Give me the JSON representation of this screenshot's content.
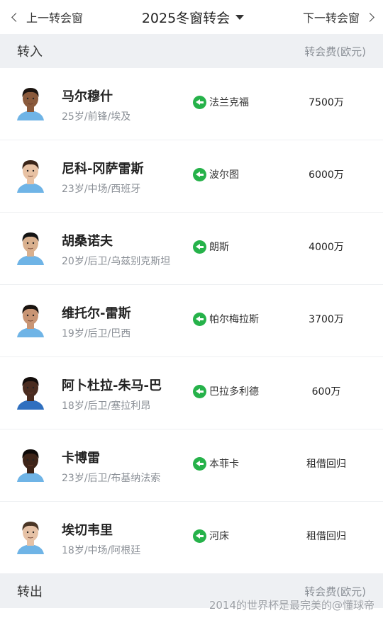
{
  "topbar": {
    "prev_label": "上一转会窗",
    "title": "2025冬窗转会",
    "next_label": "下一转会窗"
  },
  "transfer_in": {
    "label": "转入",
    "fee_header": "转会费(欧元)",
    "players": [
      {
        "name": "马尔穆什",
        "meta": "25岁/前锋/埃及",
        "club": "法兰克福",
        "fee": "7500万",
        "skin": "#8a5a3c",
        "hair": "#1b1410",
        "shirt": "#6fb4e6"
      },
      {
        "name": "尼科-冈萨雷斯",
        "meta": "23岁/中场/西班牙",
        "club": "波尔图",
        "fee": "6000万",
        "skin": "#e8c2a4",
        "hair": "#3a2418",
        "shirt": "#6fb4e6"
      },
      {
        "name": "胡桑诺夫",
        "meta": "20岁/后卫/乌兹别克斯坦",
        "club": "朗斯",
        "fee": "4000万",
        "skin": "#d9b08e",
        "hair": "#141414",
        "shirt": "#6fb4e6"
      },
      {
        "name": "维托尔-雷斯",
        "meta": "19岁/后卫/巴西",
        "club": "帕尔梅拉斯",
        "fee": "3700万",
        "skin": "#c99574",
        "hair": "#1a1410",
        "shirt": "#6fb4e6"
      },
      {
        "name": "阿卜杜拉-朱马-巴",
        "meta": "18岁/后卫/塞拉利昂",
        "club": "巴拉多利德",
        "fee": "600万",
        "skin": "#4a2c20",
        "hair": "#120c0a",
        "shirt": "#2f6fbf"
      },
      {
        "name": "卡博雷",
        "meta": "23岁/后卫/布基纳法索",
        "club": "本菲卡",
        "fee": "租借回归",
        "skin": "#3e2418",
        "hair": "#0e0a08",
        "shirt": "#6fb4e6"
      },
      {
        "name": "埃切韦里",
        "meta": "18岁/中场/阿根廷",
        "club": "河床",
        "fee": "租借回归",
        "skin": "#e6c2a6",
        "hair": "#4a3626",
        "shirt": "#6fb4e6"
      }
    ]
  },
  "transfer_out": {
    "label": "转出",
    "fee_header": "转会费(欧元)"
  },
  "watermark": "2014的世界杯是最完美的@懂球帝",
  "colors": {
    "accent_green": "#26b24a",
    "section_bg": "#eef0f3",
    "muted_text": "#8a8f96"
  }
}
